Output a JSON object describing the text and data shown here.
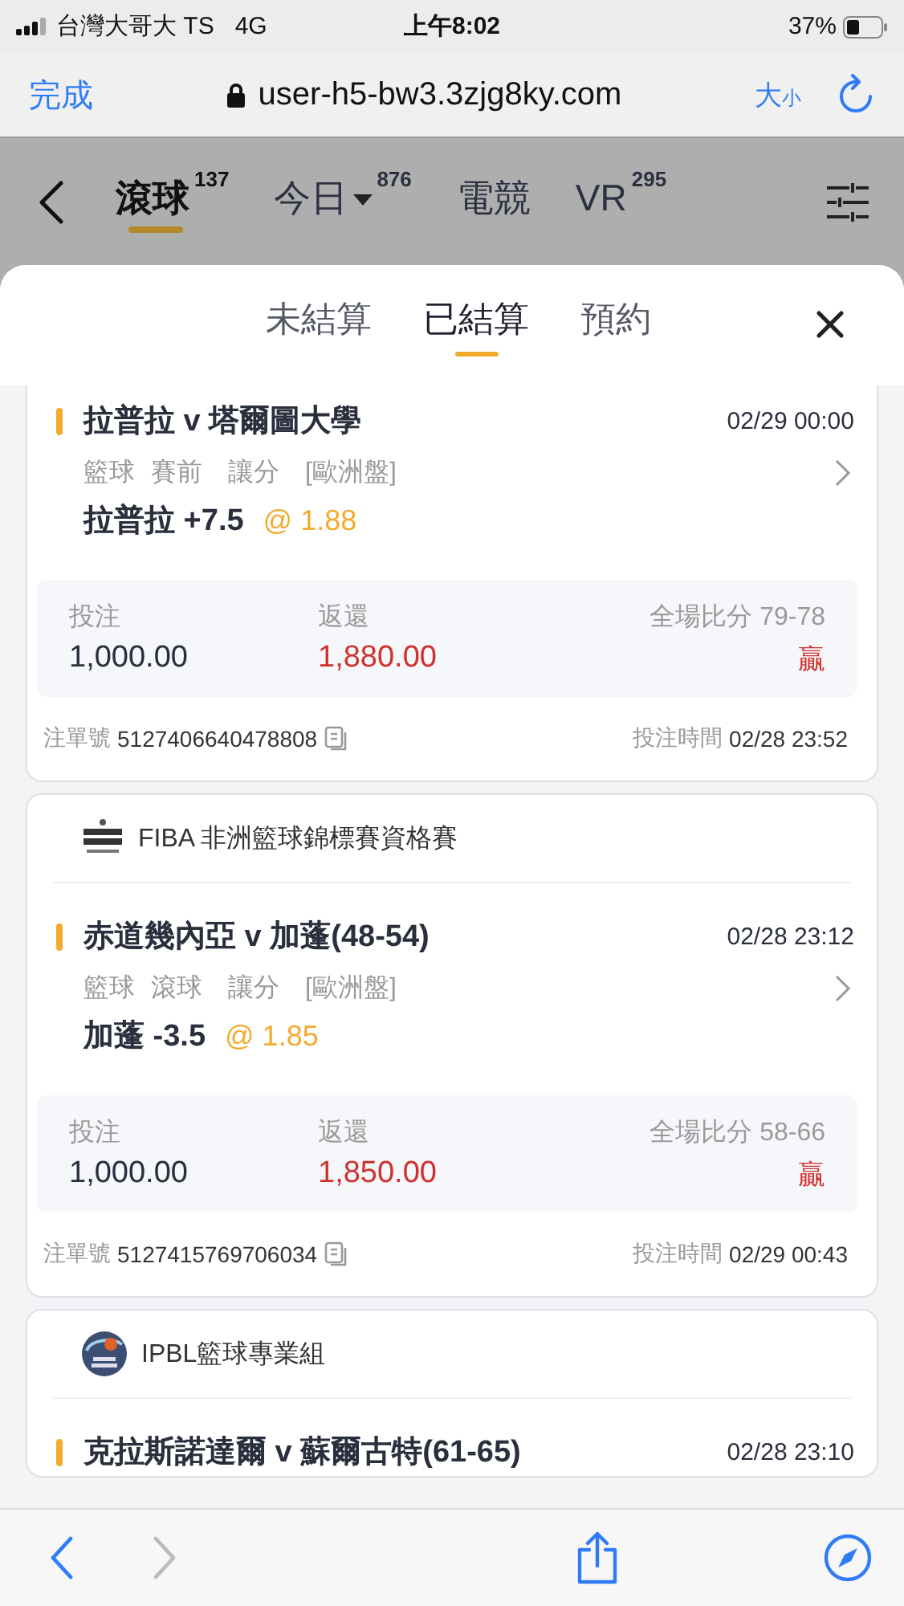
{
  "status_bar": {
    "carrier": "台灣大哥大 TS",
    "network": "4G",
    "time": "上午8:02",
    "battery": "37%"
  },
  "browser": {
    "done": "完成",
    "url": "user-h5-bw3.3zjg8ky.com",
    "text_size": "大$_{小}$"
  },
  "nav": {
    "tabs": [
      {
        "label": "滾球",
        "count": "137",
        "selected": true,
        "dropdown": false
      },
      {
        "label": "今日",
        "count": "876",
        "selected": false,
        "dropdown": true
      },
      {
        "label": "電競",
        "selected": false,
        "dropdown": false
      },
      {
        "label": "VR",
        "count": "295",
        "selected": false,
        "dropdown": false
      }
    ]
  },
  "sheet": {
    "tabs": [
      {
        "label": "未結算",
        "selected": false
      },
      {
        "label": "已結算",
        "selected": true
      },
      {
        "label": "預約",
        "selected": false
      }
    ]
  },
  "bets": [
    {
      "match": "拉普拉 v 塔爾圖大學",
      "time": "02/29 00:00",
      "tags": [
        "籃球",
        "賽前",
        "讓分",
        "[歐洲盤]"
      ],
      "pick": "拉普拉 +7.5",
      "odds": "@ 1.88",
      "stake_label": "投注",
      "stake": "1,000.00",
      "return_label": "返還",
      "return": "1,880.00",
      "score_label": "全場比分",
      "score": "79-78",
      "result": "贏",
      "bet_no_label": "注單號",
      "bet_no": "5127406640478808",
      "placed_label": "投注時間",
      "placed": "02/28 23:52"
    },
    {
      "league": {
        "name": "FIBA 非洲籃球錦標賽資格賽"
      },
      "match": "赤道幾內亞 v 加蓬(48-54)",
      "time": "02/28 23:12",
      "tags": [
        "籃球",
        "滾球",
        "讓分",
        "[歐洲盤]"
      ],
      "pick": "加蓬 -3.5",
      "odds": "@ 1.85",
      "stake_label": "投注",
      "stake": "1,000.00",
      "return_label": "返還",
      "return": "1,850.00",
      "score_label": "全場比分",
      "score": "58-66",
      "result": "贏",
      "bet_no_label": "注單號",
      "bet_no": "5127415769706034",
      "placed_label": "投注時間",
      "placed": "02/29 00:43"
    },
    {
      "league": {
        "name": "IPBL籃球專業組"
      },
      "match": "克拉斯諾達爾 v 蘇爾古特(61-65)",
      "time": "02/28 23:10"
    }
  ],
  "toolbar": [
    {
      "kind": "back",
      "disabled": false
    },
    {
      "kind": "forward",
      "disabled": true
    },
    {
      "kind": "share",
      "disabled": false
    },
    {
      "kind": "compass",
      "disabled": false
    }
  ]
}
